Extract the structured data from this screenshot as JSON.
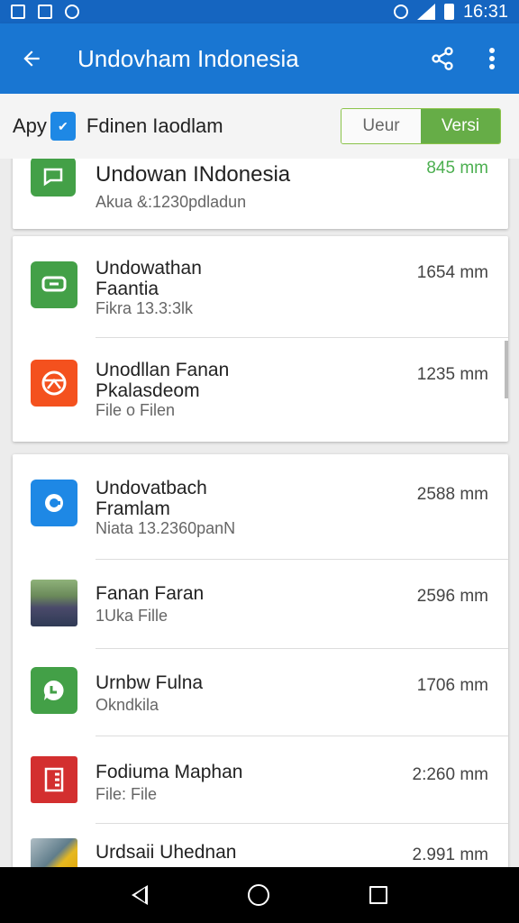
{
  "status_bar": {
    "time": "16:31",
    "icons": [
      "image-icon",
      "photo-icon",
      "sync-icon",
      "alarm-icon",
      "signal-icon",
      "battery-icon"
    ]
  },
  "app_bar": {
    "title": "Undovham Indonesia",
    "back_icon": "arrow-left-icon",
    "share_icon": "share-icon",
    "more_icon": "more-vert-icon"
  },
  "sub_bar": {
    "label": "Apy",
    "title": "Fdinen Iaodlam",
    "toggle_left": "Ueur",
    "toggle_right": "Versi"
  },
  "colors": {
    "status_bar": "#1565c0",
    "app_bar": "#1976d2",
    "accent_green": "#66ad47",
    "highlight_size": "#4caf50"
  },
  "cards": [
    {
      "rows": [
        {
          "title": "Undowan INdonesia",
          "subtitle": "Akua &:1230pdladun",
          "size": "845 mm",
          "icon": "message-icon",
          "icon_color": "#43a047"
        }
      ]
    },
    {
      "rows": [
        {
          "title": "Undowathan\nFaantia",
          "subtitle": "Fikra 13.3:3lk",
          "size": "1654 mm",
          "icon": "chat-bubble-icon",
          "icon_color": "#43a047"
        },
        {
          "title": "Unodllan Fanan\nPkalasdeom",
          "subtitle": "File o Filen",
          "size": "1235 mm",
          "icon": "globe-icon",
          "icon_color": "#f4511e"
        }
      ]
    },
    {
      "rows": [
        {
          "title": "Undovatbach\nFramlam",
          "subtitle": "Niata 13.2360panN",
          "size": "2588 mm",
          "icon": "file-circle-icon",
          "icon_color": "#1e88e5"
        },
        {
          "title": "Fanan Faran",
          "subtitle": "1Uka Fille",
          "size": "2596 mm",
          "icon": "photo-thumbnail-icon",
          "icon_color": "#5d6a52"
        },
        {
          "title": "Urnbw Fulna",
          "subtitle": "Okndkila",
          "size": "1706 mm",
          "icon": "phone-bubble-icon",
          "icon_color": "#43a047"
        },
        {
          "title": "Fodiuma Maphan",
          "subtitle": "File: File",
          "size": "2:260 mm",
          "icon": "document-list-icon",
          "icon_color": "#d32f2f"
        },
        {
          "title": "Urdsaii Uhednan",
          "subtitle": "",
          "size": "2.991 mm",
          "icon": "photo-thumbnail-icon",
          "icon_color": "#8d9aa3"
        }
      ]
    }
  ]
}
